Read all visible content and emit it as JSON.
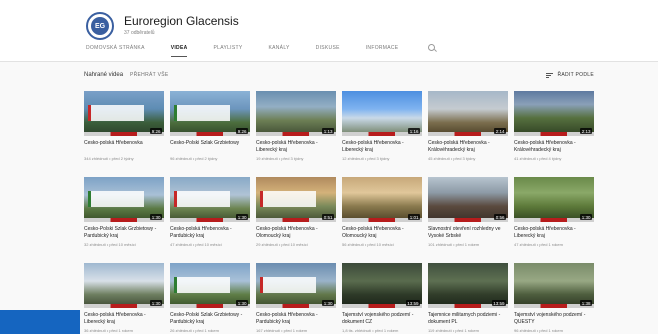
{
  "channel": {
    "name": "Euroregion Glacensis",
    "subscribers": "37 odběratelů",
    "logo_text": "EG"
  },
  "tabs": [
    {
      "label": "DOMOVSKÁ STRÁNKA",
      "active": false
    },
    {
      "label": "VIDEA",
      "active": true
    },
    {
      "label": "PLAYLISTY",
      "active": false
    },
    {
      "label": "KANÁLY",
      "active": false
    },
    {
      "label": "DISKUSE",
      "active": false
    },
    {
      "label": "INFORMACE",
      "active": false
    }
  ],
  "section": {
    "title": "Nahrané videa",
    "play_all": "PŘEHRÁT VŠE",
    "sort_label": "ŘADIT PODLE"
  },
  "videos": [
    {
      "title": "Česko-polská Hřebenovka",
      "meta": "344 zhlédnutí • před 2 týdny",
      "duration": "9:26",
      "thumb": "t1",
      "banner": "red"
    },
    {
      "title": "Česko-Polski Szlak Grzbietowy",
      "meta": "96 zhlédnutí • před 2 týdny",
      "duration": "9:26",
      "thumb": "t2",
      "banner": "green"
    },
    {
      "title": "Česko-polská Hřebenovka - Liberecký kraj",
      "meta": "19 zhlédnutí • před 3 týdny",
      "duration": "1:13",
      "thumb": "t3",
      "banner": "none"
    },
    {
      "title": "Česko-polská Hřebenovka - Liberecký kraj",
      "meta": "12 zhlédnutí • před 3 týdny",
      "duration": "1:16",
      "thumb": "t4",
      "banner": "none"
    },
    {
      "title": "Česko-polská Hřebenovka - Královéhradecký kraj",
      "meta": "45 zhlédnutí • před 3 týdny",
      "duration": "2:14",
      "thumb": "t5",
      "banner": "none"
    },
    {
      "title": "Česko-polská Hřebenovka - Královéhradecký kraj",
      "meta": "41 zhlédnutí • před 4 týdny",
      "duration": "2:13",
      "thumb": "t6",
      "banner": "none"
    },
    {
      "title": "Česko-Polski Szlak Grzbietowy - Pardubický kraj",
      "meta": "32 zhlédnutí • před 10 měsíci",
      "duration": "1:30",
      "thumb": "t7",
      "banner": "green"
    },
    {
      "title": "Česko-polská Hřebenovka - Pardubický kraj",
      "meta": "47 zhlédnutí • před 10 měsíci",
      "duration": "1:30",
      "thumb": "t8",
      "banner": "red"
    },
    {
      "title": "Česko-polská Hřebenovka - Olomoucký kraj",
      "meta": "29 zhlédnutí • před 10 měsíci",
      "duration": "0:51",
      "thumb": "t9",
      "banner": "red"
    },
    {
      "title": "Česko-polská Hřebenovka - Olomoucký kraj",
      "meta": "56 zhlédnutí • před 10 měsíci",
      "duration": "1:01",
      "thumb": "t10",
      "banner": "none"
    },
    {
      "title": "Slavnostní otevření rozhledny ve Vysoké Srbské",
      "meta": "101 zhlédnutí • před 1 rokem",
      "duration": "0:56",
      "thumb": "t11",
      "banner": "none"
    },
    {
      "title": "Česko-polská Hřebenovka - Liberecký kraj",
      "meta": "47 zhlédnutí • před 1 rokem",
      "duration": "1:30",
      "thumb": "t12",
      "banner": "none"
    },
    {
      "title": "Česko-polská Hřebenovka - Liberecký kraj",
      "meta": "36 zhlédnutí • před 1 rokem",
      "duration": "1:30",
      "thumb": "t13",
      "banner": "none"
    },
    {
      "title": "Česko-Polski Szlak Grzbietowy - Pardubický kraj",
      "meta": "26 zhlédnutí • před 1 rokem",
      "duration": "1:30",
      "thumb": "t14",
      "banner": "green"
    },
    {
      "title": "Česko-polská Hřebenovka - Pardubický kraj",
      "meta": "167 zhlédnutí • před 1 rokem",
      "duration": "1:30",
      "thumb": "t15",
      "banner": "red"
    },
    {
      "title": "Tajemství vojenského podzemí - dokument CZ",
      "meta": "1,8 tis. zhlédnutí • před 1 rokem",
      "duration": "13:59",
      "thumb": "t16",
      "banner": "none"
    },
    {
      "title": "Tajemnice militarnych podziemi - dokument PL",
      "meta": "119 zhlédnutí • před 1 rokem",
      "duration": "13:59",
      "thumb": "t17",
      "banner": "none"
    },
    {
      "title": "Tajemství vojenského podzemí - QUESTY",
      "meta": "96 zhlédnutí • před 1 rokem",
      "duration": "1:38",
      "thumb": "t18",
      "banner": "none"
    }
  ],
  "colors": {
    "accent_red": "#b71c1c",
    "accent_green": "#2e7d32",
    "bottom_bar": "#1565c0"
  }
}
